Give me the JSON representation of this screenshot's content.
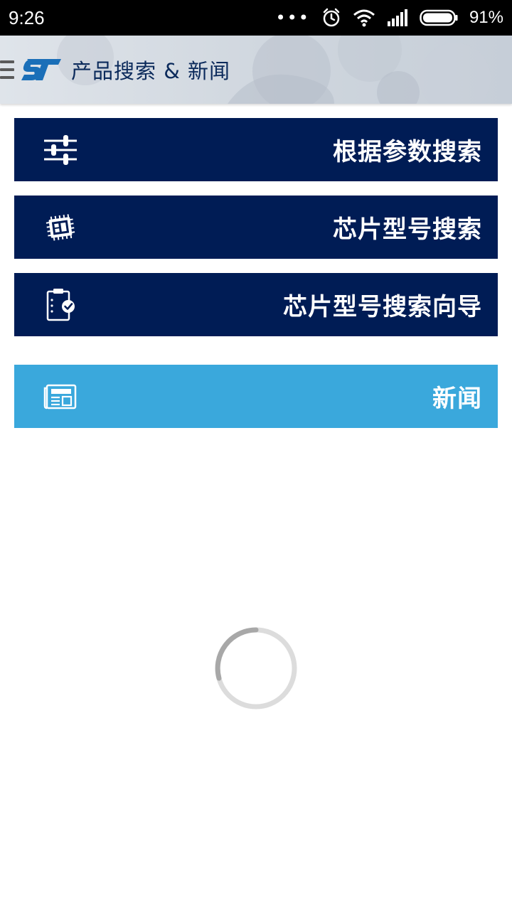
{
  "status_bar": {
    "time": "9:26",
    "dots": "•••",
    "battery_percent": "91%"
  },
  "app_bar": {
    "title": "产品搜索 & 新闻",
    "icons": [
      "menu-icon",
      "st-logo"
    ]
  },
  "buttons": [
    {
      "label": "根据参数搜索",
      "icon": "sliders-icon"
    },
    {
      "label": "芯片型号搜索",
      "icon": "chip-icon"
    },
    {
      "label": "芯片型号搜索向导",
      "icon": "clipboard-check-icon"
    },
    {
      "label": "新闻",
      "icon": "news-icon"
    }
  ],
  "colors": {
    "primary_button": "#001c55",
    "news_button": "#3aa8dc",
    "title_text": "#0b2a5b"
  }
}
